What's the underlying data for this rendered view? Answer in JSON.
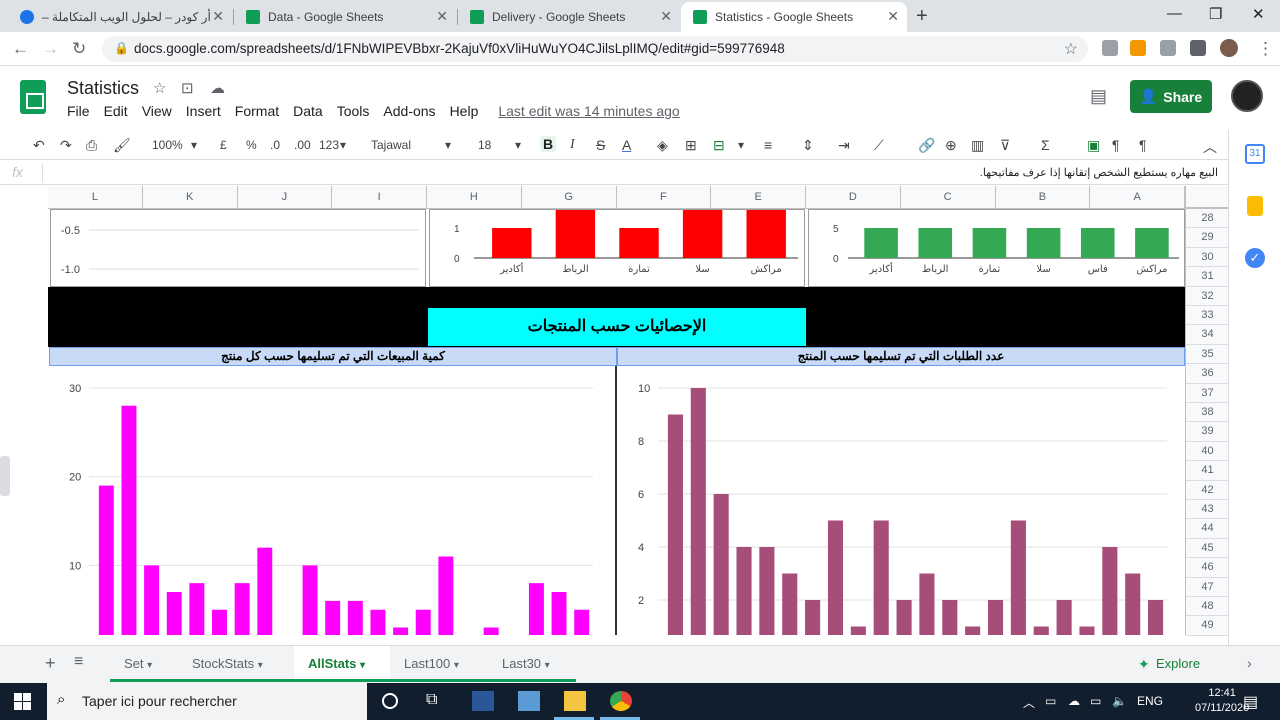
{
  "browser": {
    "tabs": [
      {
        "title": "أر كودر – لحلول الويب المتكاملة –",
        "active": false
      },
      {
        "title": "Data - Google Sheets",
        "active": false
      },
      {
        "title": "Delivery - Google Sheets",
        "active": false
      },
      {
        "title": "Statistics - Google Sheets",
        "active": true
      }
    ],
    "url": "docs.google.com/spreadsheets/d/1FNbWIPEVBbxr-2KajuVf0xVliHuWuYO4CJilsLplIMQ/edit#gid=599776948"
  },
  "doc": {
    "title": "Statistics",
    "menu": [
      "File",
      "Edit",
      "View",
      "Insert",
      "Format",
      "Data",
      "Tools",
      "Add-ons",
      "Help"
    ],
    "last_edit": "Last edit was 14 minutes ago",
    "share_label": "Share"
  },
  "toolbar": {
    "zoom": "100%",
    "currency": "£",
    "percent": "%",
    "dec_less": ".0",
    "dec_more": ".00",
    "format_more": "123",
    "font": "Tajawal",
    "font_size": "18",
    "bold": "B",
    "italic": "I",
    "strike": "S",
    "text_color": "A"
  },
  "formula_bar": {
    "fx": "fx",
    "content": "البيع مهاره يستطيع الشخص إتقانها إذا عرف مفاتيحها."
  },
  "columns": [
    {
      "letter": "L"
    },
    {
      "letter": "K"
    },
    {
      "letter": "J"
    },
    {
      "letter": "I"
    },
    {
      "letter": "H"
    },
    {
      "letter": "G"
    },
    {
      "letter": "F"
    },
    {
      "letter": "E"
    },
    {
      "letter": "D"
    },
    {
      "letter": "C"
    },
    {
      "letter": "B"
    },
    {
      "letter": "A"
    }
  ],
  "rows": [
    "28",
    "29",
    "30",
    "31",
    "32",
    "33",
    "34",
    "35",
    "36",
    "37",
    "38",
    "39",
    "40",
    "41",
    "42",
    "43",
    "44",
    "45",
    "46",
    "47",
    "48",
    "49"
  ],
  "section_title": "الإحصائيات حسب المنتجات",
  "chart_headers": {
    "left": "كمية المبيعات التي تم تسليمها حسب كل منتج",
    "right": "عدد الطلبات التي تم تسليمها حسب المنتج"
  },
  "chart_data": [
    {
      "type": "line",
      "title": "",
      "ylim": [
        -1.0,
        0
      ],
      "y_ticks": [
        "-0.5",
        "-1.0"
      ],
      "series": []
    },
    {
      "type": "bar",
      "title": "",
      "categories": [
        "أكادير",
        "الرباط",
        "تمارة",
        "سلا",
        "مراكش"
      ],
      "values": [
        1,
        2,
        1,
        2,
        2
      ],
      "y_ticks": [
        "0",
        "1"
      ],
      "color": "#ff0000"
    },
    {
      "type": "bar",
      "title": "",
      "categories": [
        "أكادير",
        "الرباط",
        "تمارة",
        "سلا",
        "فاس",
        "مراكش"
      ],
      "values": [
        5,
        5,
        5,
        5,
        5,
        5
      ],
      "y_ticks": [
        "0",
        "5"
      ],
      "color": "#34a853"
    },
    {
      "type": "bar",
      "title": "كمية المبيعات التي تم تسليمها حسب كل منتج",
      "values": [
        19,
        28,
        10,
        7,
        8,
        5,
        8,
        12,
        0,
        10,
        6,
        6,
        5,
        3,
        5,
        11,
        0,
        3,
        0,
        8,
        7,
        5
      ],
      "y_ticks": [
        "10",
        "20",
        "30"
      ],
      "ylim": [
        0,
        30
      ],
      "color": "#ff00ff"
    },
    {
      "type": "bar",
      "title": "عدد الطلبات التي تم تسليمها حسب المنتج",
      "values": [
        9,
        10,
        6,
        4,
        4,
        3,
        2,
        5,
        1,
        5,
        2,
        3,
        2,
        1,
        2,
        5,
        1,
        2,
        1,
        4,
        3,
        2
      ],
      "y_ticks": [
        "2",
        "4",
        "6",
        "8",
        "10"
      ],
      "ylim": [
        0,
        10
      ],
      "color": "#a64d79"
    }
  ],
  "sheet_tabs": [
    {
      "name": "Set"
    },
    {
      "name": "StockStats"
    },
    {
      "name": "AllStats"
    },
    {
      "name": "Last100"
    },
    {
      "name": "Last30"
    }
  ],
  "explore_label": "Explore",
  "taskbar": {
    "search_placeholder": "Taper ici pour rechercher",
    "lang": "ENG",
    "time": "12:41",
    "date": "07/11/2020"
  }
}
